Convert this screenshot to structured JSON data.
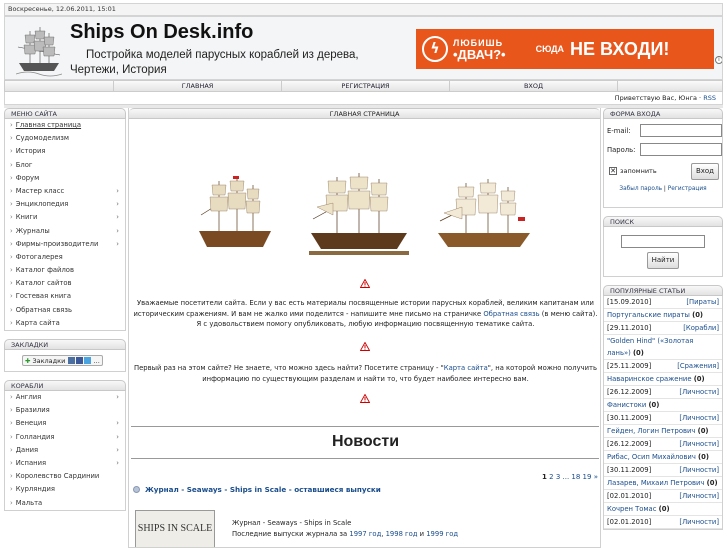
{
  "topbar": {
    "date": "Воскресенье, 12.06.2011, 15:01"
  },
  "header": {
    "title": "Ships On Desk.info",
    "subtitle": "Постройка моделей парусных кораблей из дерева, Чертежи, История"
  },
  "banner": {
    "small": "ЛЮБИШЬ",
    "large": "•ДВАЧ?•",
    "mid_line1": "СЮДА",
    "big": "НЕ ВХОДИ!",
    "brand_color": "#e8561c"
  },
  "nav": {
    "items": [
      "ГЛАВНАЯ",
      "РЕГИСТРАЦИЯ",
      "ВХОД"
    ]
  },
  "welcome": {
    "text": "Приветствую Вас, Юнга ·",
    "rss": "RSS"
  },
  "site_menu": {
    "title": "МЕНЮ САЙТА",
    "items": [
      {
        "label": "Главная страница",
        "arrow": false
      },
      {
        "label": "Судомоделизм",
        "arrow": false
      },
      {
        "label": "История",
        "arrow": false
      },
      {
        "label": "Блог",
        "arrow": false
      },
      {
        "label": "Форум",
        "arrow": false
      },
      {
        "label": "Мастер класс",
        "arrow": true
      },
      {
        "label": "Энциклопедия",
        "arrow": true
      },
      {
        "label": "Книги",
        "arrow": true
      },
      {
        "label": "Журналы",
        "arrow": true
      },
      {
        "label": "Фирмы-производители",
        "arrow": true
      },
      {
        "label": "Фотогалерея",
        "arrow": false
      },
      {
        "label": "Каталог файлов",
        "arrow": false
      },
      {
        "label": "Каталог сайтов",
        "arrow": false
      },
      {
        "label": "Гостевая книга",
        "arrow": false
      },
      {
        "label": "Обратная связь",
        "arrow": false
      },
      {
        "label": "Карта сайта",
        "arrow": false
      }
    ]
  },
  "bookmarks": {
    "title": "ЗАКЛАДКИ",
    "label": "Закладки"
  },
  "ships_menu": {
    "title": "КОРАБЛИ",
    "items": [
      {
        "label": "Англия",
        "arrow": true
      },
      {
        "label": "Бразилия",
        "arrow": false
      },
      {
        "label": "Венеция",
        "arrow": true
      },
      {
        "label": "Голландия",
        "arrow": true
      },
      {
        "label": "Дания",
        "arrow": true
      },
      {
        "label": "Испания",
        "arrow": true
      },
      {
        "label": "Королевство Сардинии",
        "arrow": false
      },
      {
        "label": "Курляндия",
        "arrow": false
      },
      {
        "label": "Мальта",
        "arrow": false
      }
    ]
  },
  "main": {
    "title": "ГЛАВНАЯ СТРАНИЦА",
    "p1_a": "Уважаемые посетители сайта. Если у вас есть материалы посвященные истории парусных кораблей, великим капитанам или историческим сражениям. И вам не жалко ими поделится - напишите мне письмо на страничке ",
    "p1_link": "Обратная связь",
    "p1_b": " (в меню сайта). Я с удовольствием помогу опубликовать, любую информацию посвященную тематике сайта.",
    "p2_a": "Первый раз на этом сайте? Не знаете, что можно здесь найти? Посетите страницу - \"",
    "p2_link": "Карта сайта",
    "p2_b": "\", на которой можно получить информацию по существующим разделам и найти то, что будет наиболее интересно вам.",
    "news_title": "Новости",
    "pager": {
      "current": "1",
      "pages": "2 3 ... 18 19",
      "next": "»"
    },
    "entry": {
      "title": "Журнал - Seaways - Ships in Scale - оставшиеся выпуски",
      "cover": "SHIPS IN SCALE",
      "line1": "Журнал - Seaways - Ships in Scale",
      "line2": "Последние выпуски журнала за ",
      "y1": "1997 год",
      "sep1": ", ",
      "y2": "1998 год",
      "sep2": " и ",
      "y3": "1999 год"
    }
  },
  "login": {
    "title": "ФОРМА ВХОДА",
    "email_label": "E-mail:",
    "password_label": "Пароль:",
    "remember": "запомнить",
    "submit": "Вход",
    "forgot": "Забыл пароль",
    "sep": " | ",
    "register": "Регистрация"
  },
  "search": {
    "title": "ПОИСК",
    "button": "Найти"
  },
  "popular": {
    "title": "ПОПУЛЯРНЫЕ СТАТЬИ",
    "items": [
      {
        "date": "[15.09.2010]",
        "cat": "[Пираты]",
        "title": "Португальские пираты",
        "count": "(0)"
      },
      {
        "date": "[29.11.2010]",
        "cat": "[Корабли]",
        "title": "\"Golden Hind\" («Золотая лань»)",
        "count": "(0)"
      },
      {
        "date": "[25.11.2009]",
        "cat": "[Сражения]",
        "title": "Наваринское сражение",
        "count": "(0)"
      },
      {
        "date": "[26.12.2009]",
        "cat": "[Личности]",
        "title": "Фанистоки",
        "count": "(0)"
      },
      {
        "date": "[30.11.2009]",
        "cat": "[Личности]",
        "title": "Гейден, Логин Петрович",
        "count": "(0)"
      },
      {
        "date": "[26.12.2009]",
        "cat": "[Личности]",
        "title": "Рибас, Осип Михайлович",
        "count": "(0)"
      },
      {
        "date": "[30.11.2009]",
        "cat": "[Личности]",
        "title": "Лазарев, Михаил Петрович",
        "count": "(0)"
      },
      {
        "date": "[02.01.2010]",
        "cat": "[Личности]",
        "title": "Кочрен Томас",
        "count": "(0)"
      },
      {
        "date": "[02.01.2010]",
        "cat": "[Личности]",
        "title": "",
        "count": ""
      }
    ]
  }
}
